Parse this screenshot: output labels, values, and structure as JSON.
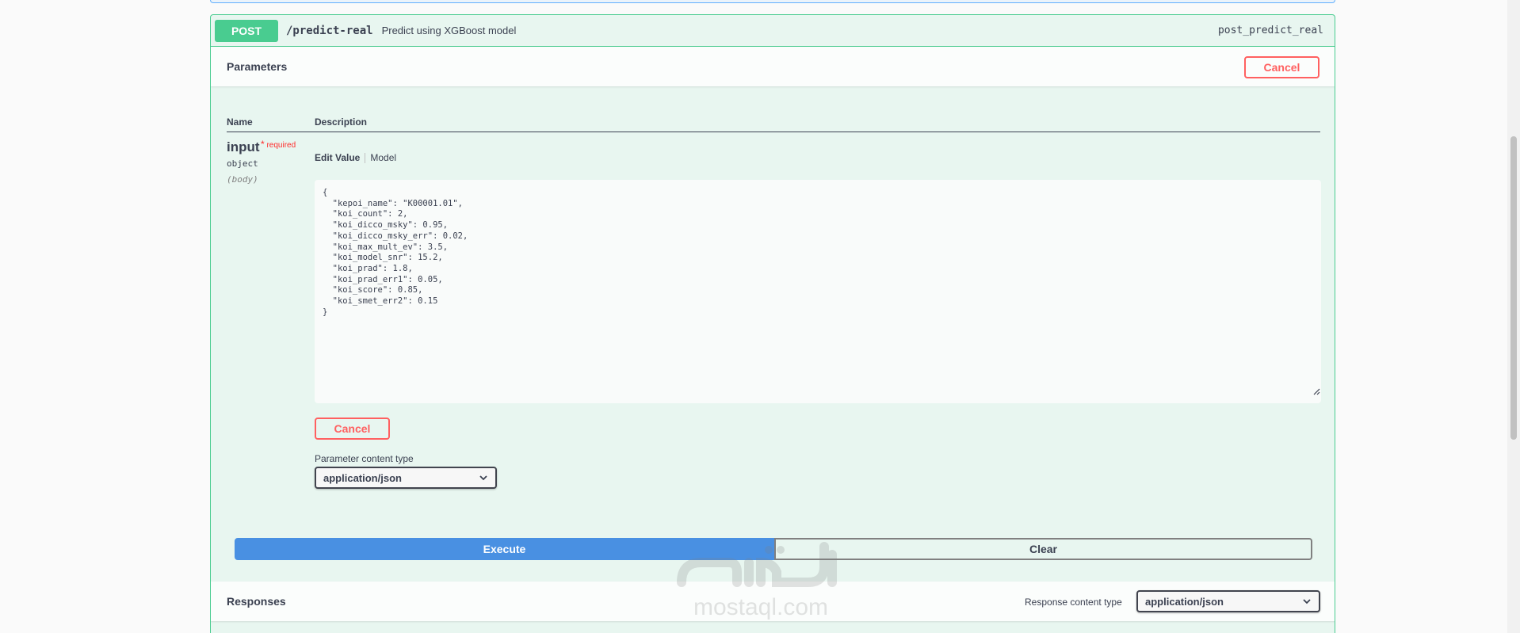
{
  "operation": {
    "method": "POST",
    "path": "/predict-real",
    "summary": "Predict using XGBoost model",
    "operation_id": "post_predict_real"
  },
  "parameters": {
    "title": "Parameters",
    "cancel_label": "Cancel",
    "column_name": "Name",
    "column_description": "Description",
    "param": {
      "name": "input",
      "required_star": "*",
      "required_label": "required",
      "type": "object",
      "in": "(body)"
    },
    "tabs": [
      "Edit Value",
      "Model"
    ],
    "body_value": "{\n  \"kepoi_name\": \"K00001.01\",\n  \"koi_count\": 2,\n  \"koi_dicco_msky\": 0.95,\n  \"koi_dicco_msky_err\": 0.02,\n  \"koi_max_mult_ev\": 3.5,\n  \"koi_model_snr\": 15.2,\n  \"koi_prad\": 1.8,\n  \"koi_prad_err1\": 0.05,\n  \"koi_score\": 0.85,\n  \"koi_smet_err2\": 0.15\n}",
    "body_cancel_label": "Cancel",
    "content_type_label": "Parameter content type",
    "content_type_value": "application/json"
  },
  "actions": {
    "execute_label": "Execute",
    "clear_label": "Clear"
  },
  "responses": {
    "title": "Responses",
    "content_type_label": "Response content type",
    "content_type_value": "application/json"
  },
  "watermark": {
    "text": "mostaql.com"
  },
  "colors": {
    "post_green": "#49cc90",
    "execute_blue": "#4990e2",
    "cancel_red": "#ff6060"
  }
}
